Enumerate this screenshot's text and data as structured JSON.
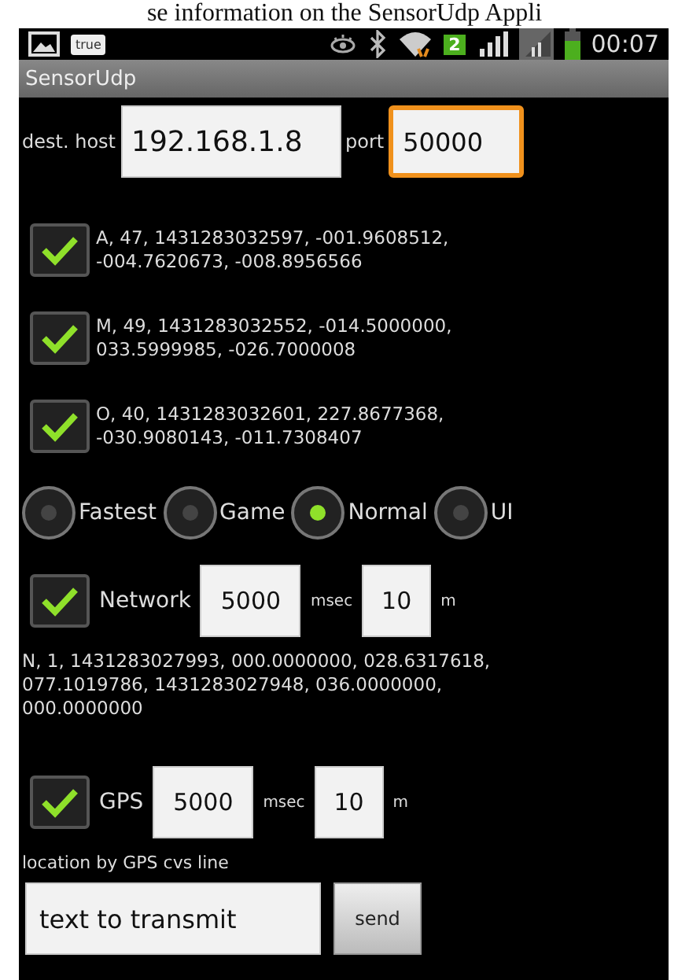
{
  "caption": "se information on the SensorUdp Appli",
  "status_bar": {
    "notification_badge": "true",
    "sim_badge": "2",
    "time": "00:07"
  },
  "window": {
    "title": "SensorUdp"
  },
  "destination": {
    "host_label": "dest. host",
    "host": "192.168.1.8",
    "port_label": "port",
    "port": "50000",
    "port_focused": true
  },
  "sensors": [
    {
      "checked": true,
      "reading": "A, 47, 1431283032597, -001.9608512, -004.7620673, -008.8956566"
    },
    {
      "checked": true,
      "reading": "M, 49, 1431283032552, -014.5000000, 033.5999985, -026.7000008"
    },
    {
      "checked": true,
      "reading": "O, 40, 1431283032601, 227.8677368, -030.9080143, -011.7308407"
    }
  ],
  "rates": [
    {
      "label": "Fastest",
      "selected": false
    },
    {
      "label": "Game",
      "selected": false
    },
    {
      "label": "Normal",
      "selected": true
    },
    {
      "label": "UI",
      "selected": false
    }
  ],
  "network": {
    "checked": true,
    "label": "Network",
    "interval": "5000",
    "interval_unit": "msec",
    "distance": "10",
    "distance_unit": "m",
    "reading": "N, 1, 1431283027993, 000.0000000, 028.6317618, 077.1019786, 1431283027948, 036.0000000, 000.0000000"
  },
  "gps": {
    "checked": true,
    "label": "GPS",
    "interval": "5000",
    "interval_unit": "msec",
    "distance": "10",
    "distance_unit": "m",
    "reading": "location by GPS cvs line"
  },
  "message": {
    "value": "text to transmit",
    "button": "send"
  }
}
